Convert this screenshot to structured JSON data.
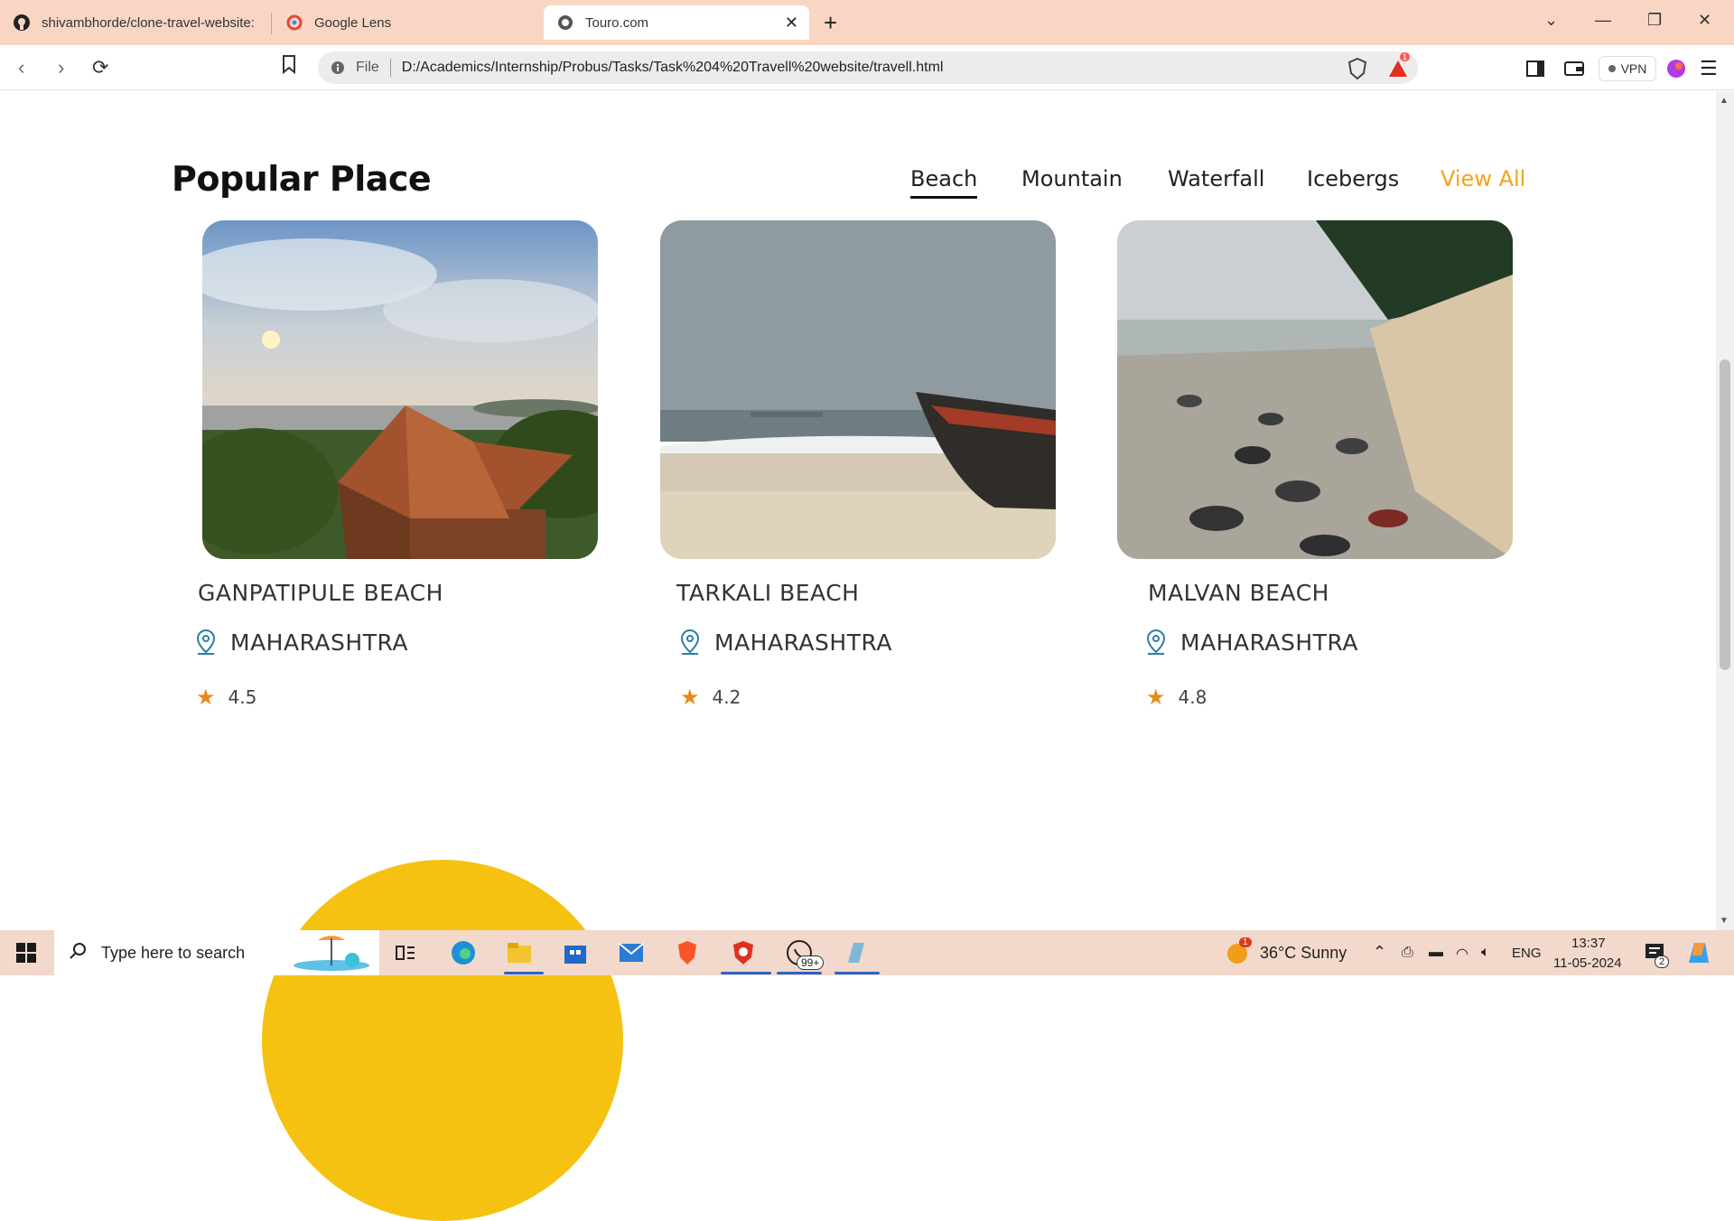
{
  "browser": {
    "tabs": [
      {
        "title": "shivambhorde/clone-travel-website:",
        "icon": "github-icon"
      },
      {
        "title": "Google Lens",
        "icon": "google-lens-icon"
      },
      {
        "title": "Touro.com",
        "icon": "globe-icon",
        "active": true
      }
    ],
    "address": {
      "scheme": "File",
      "url": "D:/Academics/Internship/Probus/Tasks/Task%204%20Travell%20website/travell.html"
    },
    "vpn_label": "VPN",
    "notification_count": "1"
  },
  "page": {
    "section_title": "Popular Place",
    "filters": [
      "Beach",
      "Mountain",
      "Waterfall",
      "Icebergs"
    ],
    "active_filter": "Beach",
    "view_all": "View All",
    "accent_color": "#f4a21a",
    "cards": [
      {
        "name": "GANPATIPULE BEACH",
        "location": "MAHARASHTRA",
        "rating": "4.5"
      },
      {
        "name": "TARKALI BEACH",
        "location": "MAHARASHTRA",
        "rating": "4.2"
      },
      {
        "name": "MALVAN BEACH",
        "location": "MAHARASHTRA",
        "rating": "4.8"
      }
    ]
  },
  "taskbar": {
    "search_placeholder": "Type here to search",
    "weather": "36°C  Sunny",
    "weather_badge": "1",
    "language": "ENG",
    "time": "13:37",
    "date": "11-05-2024",
    "whatsapp_badge": "99+",
    "notification_count": "2"
  }
}
